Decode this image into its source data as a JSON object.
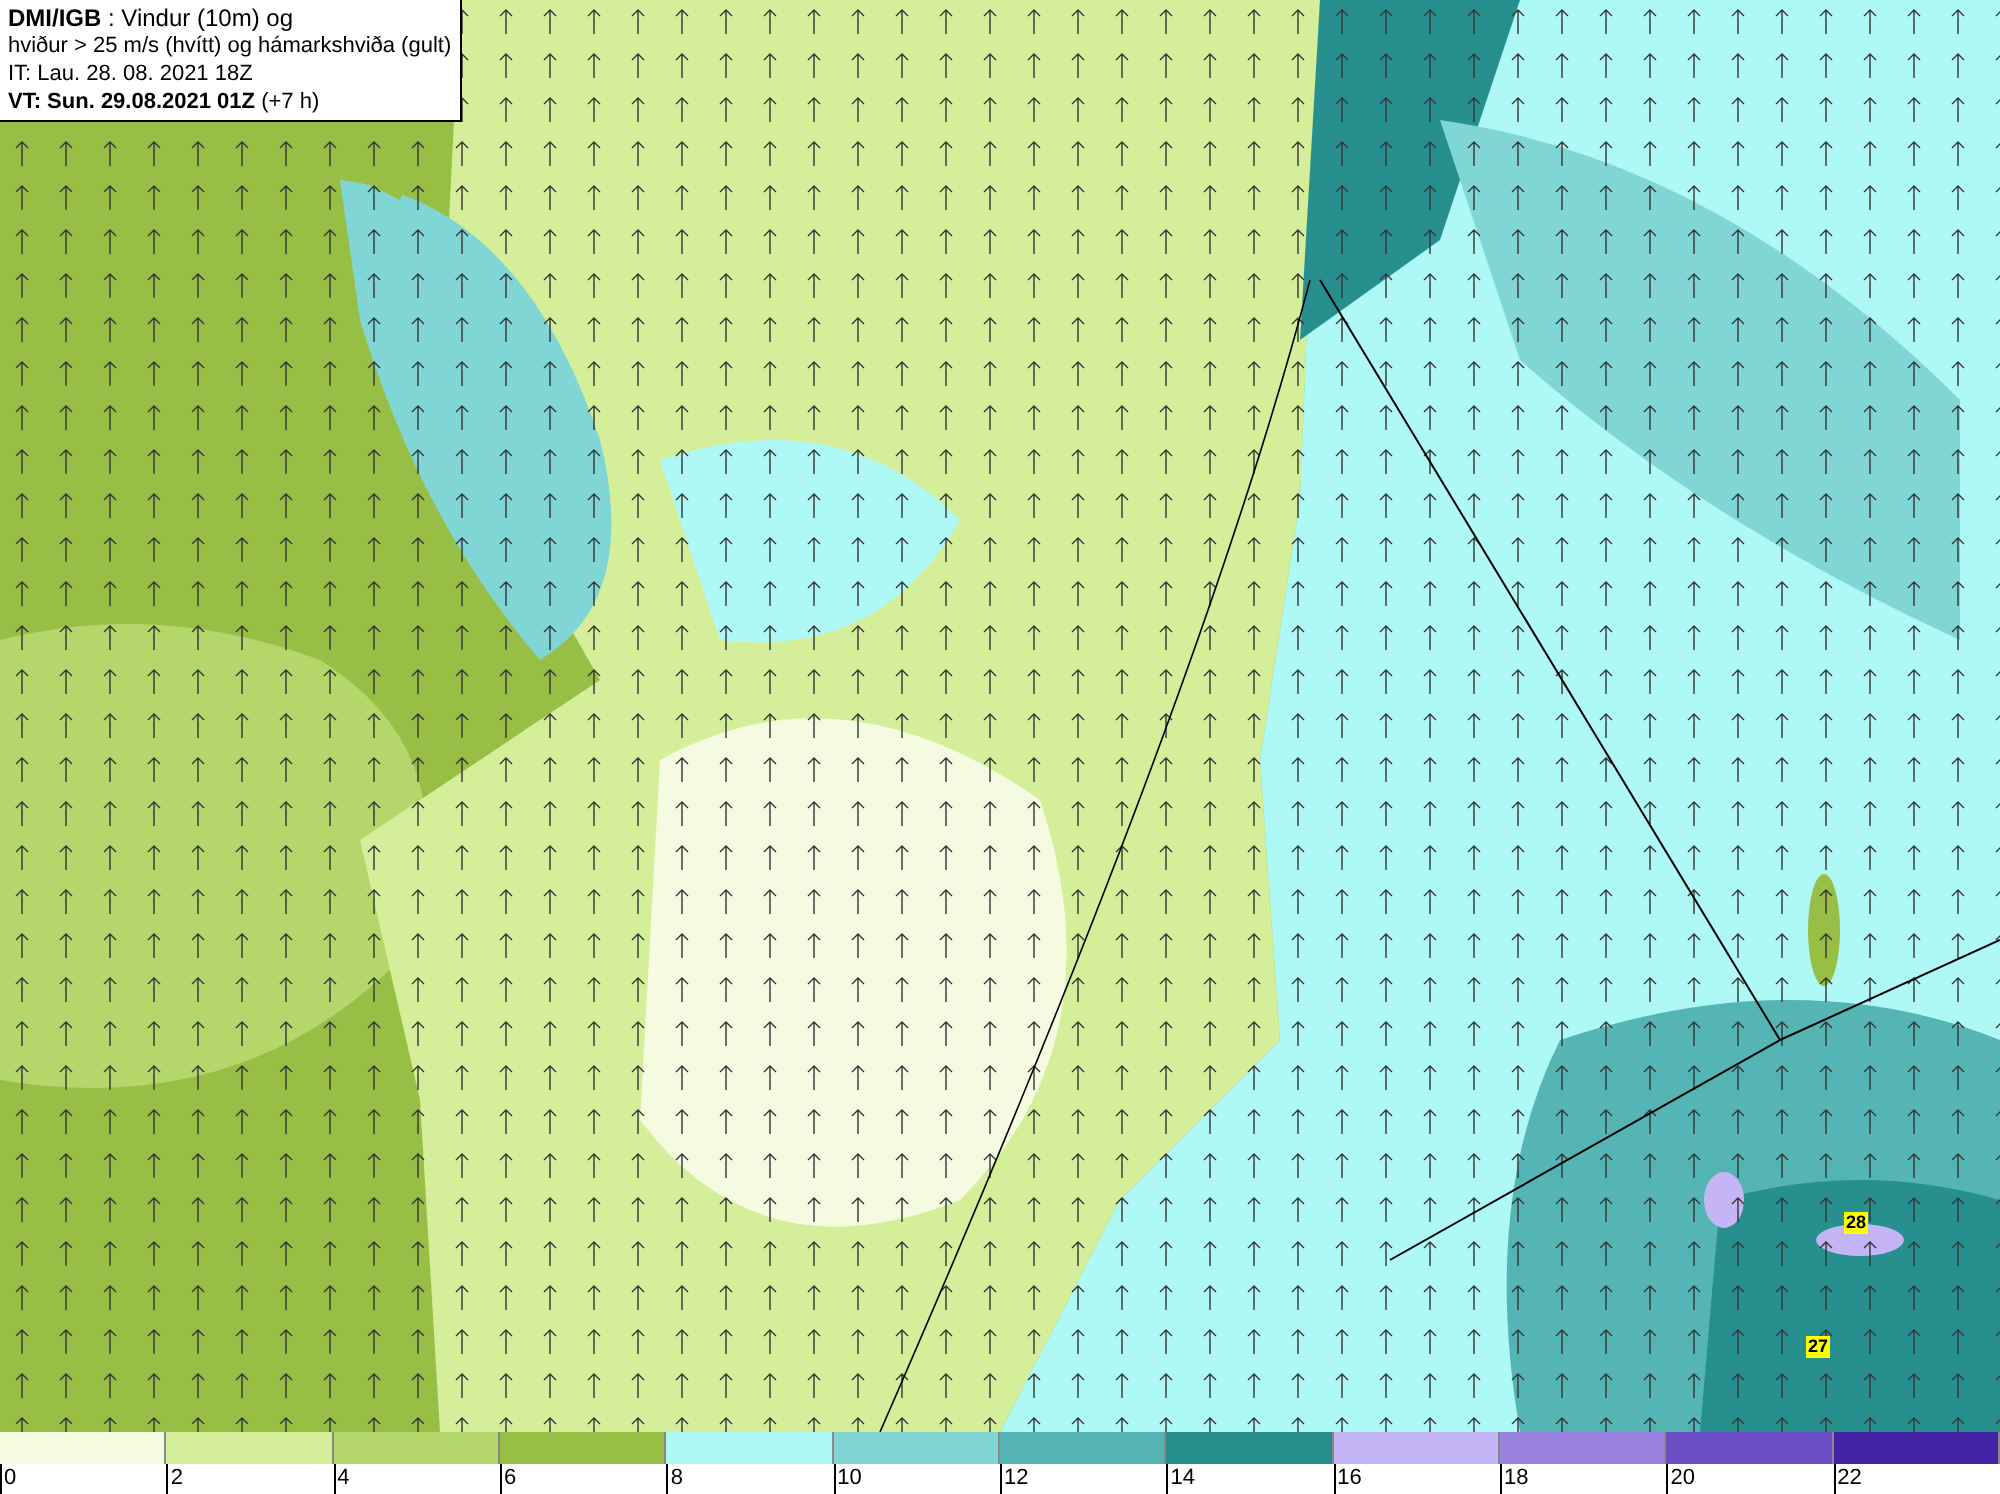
{
  "header": {
    "line_1": "**DMI/IGB** : Vindur (10m) og",
    "line_2": "hviður > 25 m/s (hvítt) og hámarkshviða (gult)",
    "line_3": "IT: Lau. 28. 08. 2021 18Z",
    "line_4": "**VT: Sun. 29.08.2021 01Z** (+7 h)"
  },
  "map": {
    "gust_labels": [
      "28",
      "27"
    ]
  },
  "legend": [
    {
      "color": "#f5fbe0",
      "label": "0"
    },
    {
      "color": "#d4ee9a",
      "label": "2"
    },
    {
      "color": "#b3d76a",
      "label": "4"
    },
    {
      "color": "#98bf45",
      "label": "6"
    },
    {
      "color": "#aef9f6",
      "label": "8"
    },
    {
      "color": "#7fd6d4",
      "label": "10"
    },
    {
      "color": "#55b5b5",
      "label": "12"
    },
    {
      "color": "#27908f",
      "label": "14"
    },
    {
      "color": "#c4b6f6",
      "label": "16"
    },
    {
      "color": "#9a83e0",
      "label": "18"
    },
    {
      "color": "#6c4cc4",
      "label": "20"
    },
    {
      "color": "#4322a5",
      "label": "22"
    }
  ]
}
